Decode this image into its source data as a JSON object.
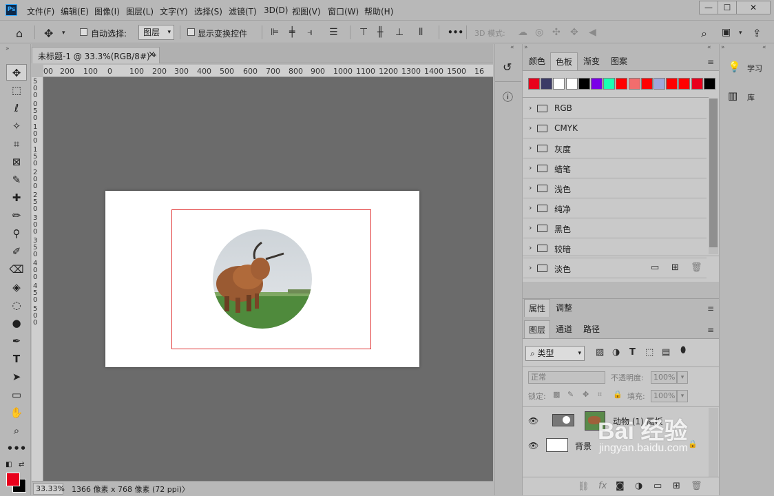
{
  "menu": [
    "文件(F)",
    "编辑(E)",
    "图像(I)",
    "图层(L)",
    "文字(Y)",
    "选择(S)",
    "滤镜(T)",
    "3D(D)",
    "视图(V)",
    "窗口(W)",
    "帮助(H)"
  ],
  "app_logo": "Ps",
  "window_controls": {
    "min": "—",
    "max": "☐",
    "close": "✕"
  },
  "options": {
    "auto_select_label": "自动选择:",
    "layer_select_value": "图层",
    "show_transform_label": "显示变换控件",
    "more_label": "•••",
    "mode_3d_label": "3D 模式:"
  },
  "document": {
    "tab_title": "未标题-1 @ 33.3%(RGB/8#) *",
    "tab_close": "×",
    "zoom": "33.33%",
    "info": "1366 像素 x 768 像素 (72 ppi)",
    "info_arrow": "〉",
    "ruler_h": [
      "00",
      "200",
      "100",
      "0",
      "100",
      "200",
      "300",
      "400",
      "500",
      "600",
      "700",
      "800",
      "900",
      "1000",
      "1100",
      "1200",
      "1300",
      "1400",
      "1500",
      "16"
    ],
    "ruler_v": [
      "5",
      "0",
      "0",
      "0",
      "5",
      "0",
      "1",
      "0",
      "0",
      "1",
      "5",
      "0",
      "2",
      "0",
      "0",
      "2",
      "5",
      "0",
      "3",
      "0",
      "0",
      "3",
      "5",
      "0",
      "4",
      "0",
      "0",
      "4",
      "5",
      "0",
      "5",
      "0",
      "0"
    ]
  },
  "swatches_panel": {
    "tabs": [
      "颜色",
      "色板",
      "渐变",
      "图案"
    ],
    "active_tab": "色板",
    "colors": [
      "#e8001c",
      "#3b3a66",
      "#ffffff",
      "#ffffff",
      "#000000",
      "#7a00e8",
      "#1bffb2",
      "#ff0000",
      "#f26d6d",
      "#ff0000",
      "#9fa8da",
      "#ff0000",
      "#ff0000",
      "#e8001c",
      "#000000"
    ],
    "folders": [
      "RGB",
      "CMYK",
      "灰度",
      "蜡笔",
      "浅色",
      "纯净",
      "黑色",
      "较暗",
      "淡色"
    ]
  },
  "props_panel": {
    "tabs": [
      "属性",
      "调整"
    ]
  },
  "layers_panel": {
    "tabs": [
      "图层",
      "通道",
      "路径"
    ],
    "active_tab": "图层",
    "filter_label": "类型",
    "blend_mode": "正常",
    "opacity_label": "不透明度:",
    "opacity_value": "100%",
    "lock_label": "锁定:",
    "fill_label": "填充:",
    "fill_value": "100%",
    "layers": [
      {
        "name": "动物 (1) 画板"
      },
      {
        "name": "背景"
      }
    ]
  },
  "right_panel": {
    "learn_label": "学习",
    "library_label": "库"
  },
  "watermark": {
    "brand": "Bai 经验",
    "url": "jingyan.baidu.com"
  },
  "artboard_colors": {
    "frame": "#e03030",
    "canvas_bg": "#6b6b6b"
  }
}
